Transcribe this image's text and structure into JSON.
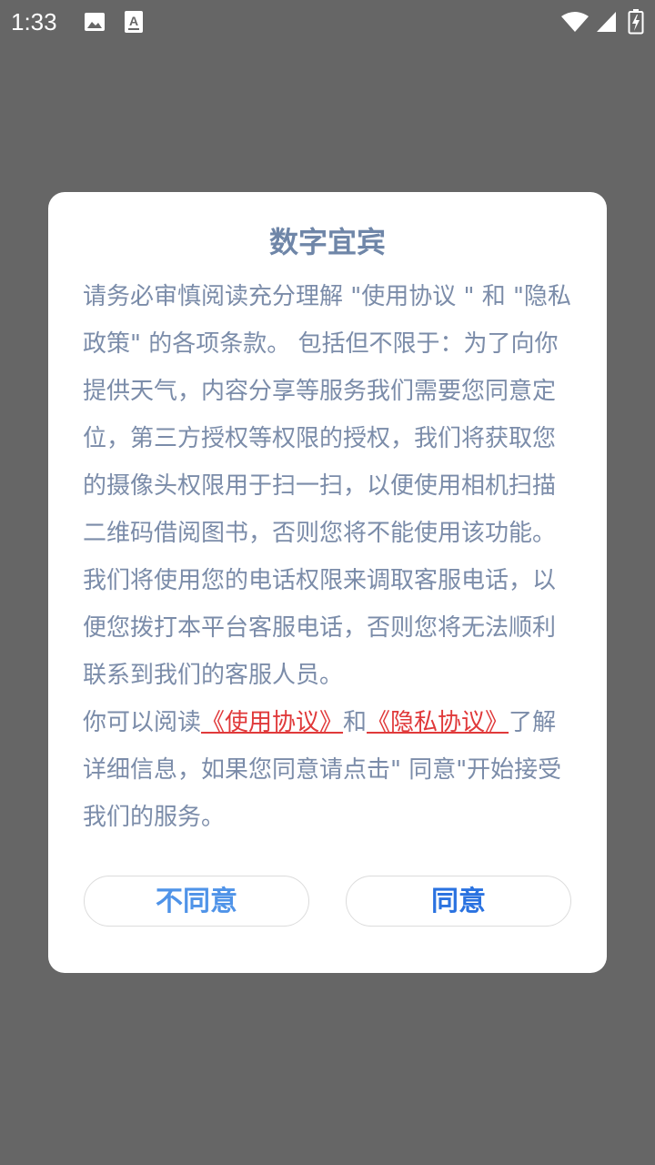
{
  "status_bar": {
    "time": "1:33",
    "icons": [
      "image-icon",
      "a-text-icon",
      "wifi-icon",
      "signal-icon",
      "battery-charging-icon"
    ]
  },
  "dialog": {
    "title": "数字宜宾",
    "paragraph1": "请务必审慎阅读充分理解 \"使用协议 \" 和 \"隐私政策\" 的各项条款。 包括但不限于：为了向你提供天气，内容分享等服务我们需要您同意定位，第三方授权等权限的授权，我们将获取您的摄像头权限用于扫一扫，以便使用相机扫描二维码借阅图书，否则您将不能使用该功能。我们将使用您的电话权限来调取客服电话，以便您拨打本平台客服电话，否则您将无法顺利联系到我们的客服人员。",
    "paragraph2_prefix": "你可以阅读",
    "link_usage": "《使用协议》",
    "paragraph2_and": "和",
    "link_privacy": "《隐私协议》",
    "paragraph2_suffix": "了解详细信息，如果您同意请点击\" 同意\"开始接受我们的服务。",
    "disagree_label": "不同意",
    "agree_label": "同意"
  },
  "colors": {
    "overlay": "#666666",
    "title": "#6f86a8",
    "body_text": "#7b8ca9",
    "link": "#e0393a",
    "disagree": "#4f93e8",
    "agree": "#2a72e0"
  }
}
